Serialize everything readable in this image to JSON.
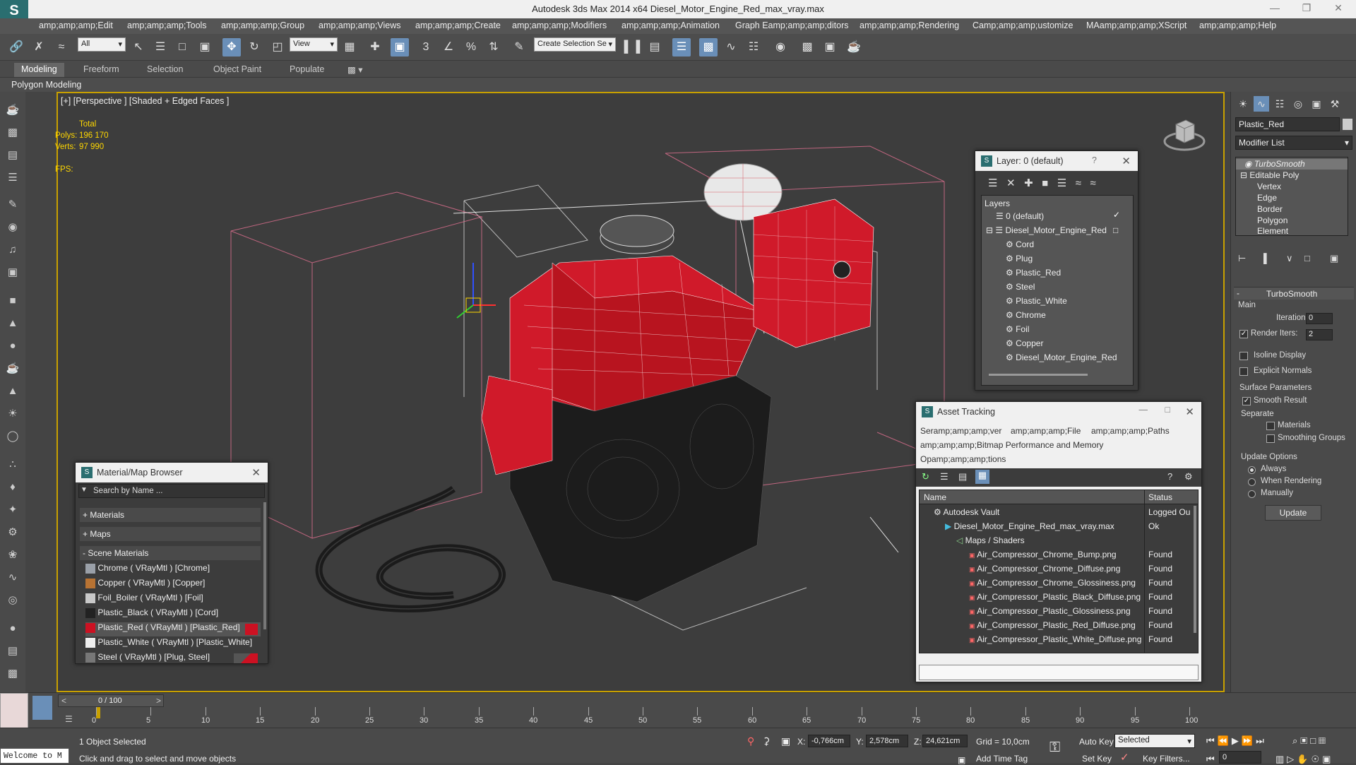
{
  "title_bar": {
    "app_logo": "S",
    "title": "Autodesk 3ds Max  2014 x64    Diesel_Motor_Engine_Red_max_vray.max"
  },
  "menu": [
    "amp;amp;amp;Edit",
    "amp;amp;amp;Tools",
    "amp;amp;amp;Group",
    "amp;amp;amp;Views",
    "amp;amp;amp;Create",
    "amp;amp;amp;Modifiers",
    "amp;amp;amp;Animation",
    "Graph Eamp;amp;amp;ditors",
    "amp;amp;amp;Rendering",
    "Camp;amp;amp;ustomize",
    "MAamp;amp;amp;XScript",
    "amp;amp;amp;Help"
  ],
  "toolbar": {
    "filter_value": "All",
    "refcoord_value": "View",
    "selection_set_placeholder": "Create Selection Se"
  },
  "ribbon": {
    "tabs": [
      "Modeling",
      "Freeform",
      "Selection",
      "Object Paint",
      "Populate"
    ],
    "sub_label": "Polygon Modeling"
  },
  "viewport": {
    "label": "[+] [Perspective ] [Shaded + Edged Faces ]",
    "stats_header": "Total",
    "polys_label": "Polys:",
    "polys_value": "196 170",
    "verts_label": "Verts:",
    "verts_value": "97 990",
    "fps_label": "FPS:"
  },
  "command_panel": {
    "object_name": "Plastic_Red",
    "modifier_list": "Modifier List",
    "stack": [
      "TurboSmooth",
      "Editable Poly",
      "Vertex",
      "Edge",
      "Border",
      "Polygon",
      "Element"
    ],
    "rollout_title": "TurboSmooth",
    "main_group": "Main",
    "iterations_label": "Iterations:",
    "iterations_value": "0",
    "render_iters_label": "Render Iters:",
    "render_iters_value": "2",
    "isoline_label": "Isoline Display",
    "explicit_normals_label": "Explicit Normals",
    "surface_params_label": "Surface Parameters",
    "smooth_result_label": "Smooth Result",
    "separate_label": "Separate",
    "materials_label": "Materials",
    "smoothing_groups_label": "Smoothing Groups",
    "update_options_label": "Update Options",
    "always_label": "Always",
    "when_rendering_label": "When Rendering",
    "manually_label": "Manually",
    "update_button": "Update"
  },
  "layer_dialog": {
    "title": "Layer: 0 (default)",
    "help": "?",
    "header": "Layers",
    "items": [
      {
        "label": "0 (default)",
        "indent": 0
      },
      {
        "label": "Diesel_Motor_Engine_Red",
        "indent": 0
      },
      {
        "label": "Cord",
        "indent": 1
      },
      {
        "label": "Plug",
        "indent": 1
      },
      {
        "label": "Plastic_Red",
        "indent": 1
      },
      {
        "label": "Steel",
        "indent": 1
      },
      {
        "label": "Plastic_White",
        "indent": 1
      },
      {
        "label": "Chrome",
        "indent": 1
      },
      {
        "label": "Foil",
        "indent": 1
      },
      {
        "label": "Copper",
        "indent": 1
      },
      {
        "label": "Diesel_Motor_Engine_Red",
        "indent": 1
      }
    ]
  },
  "asset_tracking": {
    "title": "Asset Tracking",
    "menu": [
      "Seramp;amp;amp;ver",
      "amp;amp;amp;File",
      "amp;amp;amp;Paths",
      "amp;amp;amp;Bitmap Performance and Memory",
      "Opamp;amp;amp;tions"
    ],
    "col_name": "Name",
    "col_status": "Status",
    "rows": [
      {
        "name": "Autodesk Vault",
        "status": "Logged Ou",
        "indent": 1
      },
      {
        "name": "Diesel_Motor_Engine_Red_max_vray.max",
        "status": "Ok",
        "indent": 2
      },
      {
        "name": "Maps / Shaders",
        "status": "",
        "indent": 3
      },
      {
        "name": "Air_Compressor_Chrome_Bump.png",
        "status": "Found",
        "indent": 4
      },
      {
        "name": "Air_Compressor_Chrome_Diffuse.png",
        "status": "Found",
        "indent": 4
      },
      {
        "name": "Air_Compressor_Chrome_Glossiness.png",
        "status": "Found",
        "indent": 4
      },
      {
        "name": "Air_Compressor_Plastic_Black_Diffuse.png",
        "status": "Found",
        "indent": 4
      },
      {
        "name": "Air_Compressor_Plastic_Glossiness.png",
        "status": "Found",
        "indent": 4
      },
      {
        "name": "Air_Compressor_Plastic_Red_Diffuse.png",
        "status": "Found",
        "indent": 4
      },
      {
        "name": "Air_Compressor_Plastic_White_Diffuse.png",
        "status": "Found",
        "indent": 4
      }
    ]
  },
  "material_browser": {
    "title": "Material/Map Browser",
    "search_placeholder": "Search by Name ...",
    "sections": [
      "+ Materials",
      "+ Maps",
      "- Scene Materials"
    ],
    "materials": [
      {
        "label": "Chrome  ( VRayMtl ) [Chrome]",
        "swatch": "#9aa0a8",
        "selected": false
      },
      {
        "label": "Copper  ( VRayMtl ) [Copper]",
        "swatch": "#b87333",
        "selected": false
      },
      {
        "label": "Foil_Boiler  ( VRayMtl ) [Foil]",
        "swatch": "#c8c8c8",
        "selected": false
      },
      {
        "label": "Plastic_Black  ( VRayMtl ) [Cord]",
        "swatch": "#222222",
        "selected": false
      },
      {
        "label": "Plastic_Red  ( VRayMtl ) [Plastic_Red]",
        "swatch": "#cc1122",
        "selected": true
      },
      {
        "label": "Plastic_White  ( VRayMtl ) [Plastic_White]",
        "swatch": "#eeeeee",
        "selected": false
      },
      {
        "label": "Steel  ( VRayMtl ) [Plug, Steel]",
        "swatch": "#777777",
        "selected": false
      }
    ]
  },
  "timeline": {
    "frame_label": "0 / 100",
    "ticks": [
      "0",
      "5",
      "10",
      "15",
      "20",
      "25",
      "30",
      "35",
      "40",
      "45",
      "50",
      "55",
      "60",
      "65",
      "70",
      "75",
      "80",
      "85",
      "90",
      "95",
      "100"
    ]
  },
  "status": {
    "maxscript": "Welcome to M",
    "selected_info": "1 Object Selected",
    "prompt": "Click and drag to select and move objects",
    "x_label": "X:",
    "x_value": "-0,766cm",
    "y_label": "Y:",
    "y_value": "2,578cm",
    "z_label": "Z:",
    "z_value": "24,621cm",
    "grid": "Grid = 10,0cm",
    "add_time_tag": "Add Time Tag",
    "auto_key": "Auto Key",
    "set_key": "Set Key",
    "selected_dropdown": "Selected",
    "key_filters": "Key Filters...",
    "frame_value": "0"
  },
  "colors": {
    "accent": "#6a8fb8",
    "viewport_border": "#c8a000",
    "stats": "#ffd700",
    "red_mesh": "#d01a2a"
  }
}
